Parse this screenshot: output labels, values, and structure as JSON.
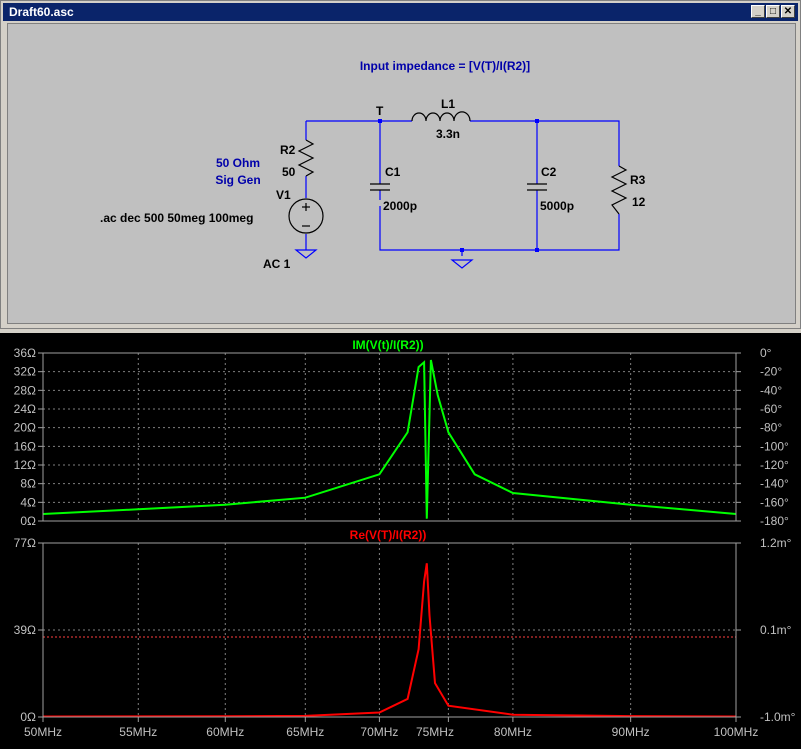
{
  "window": {
    "title": "Draft60.asc",
    "buttons": [
      "_",
      "□",
      "✕"
    ]
  },
  "schematic": {
    "directive": "Input impedance = [V(T)/I(R2)]",
    "node_label": "T",
    "sig_gen_line1": "50 Ohm",
    "sig_gen_line2": "Sig Gen",
    "ac_command": ".ac dec 500 50meg 100meg",
    "components": {
      "R2": {
        "name": "R2",
        "value": "50"
      },
      "V1": {
        "name": "V1",
        "value": "AC 1"
      },
      "L1": {
        "name": "L1",
        "value": "3.3n"
      },
      "C1": {
        "name": "C1",
        "value": "2000p"
      },
      "C2": {
        "name": "C2",
        "value": "5000p"
      },
      "R3": {
        "name": "R3",
        "value": "12"
      }
    }
  },
  "colors": {
    "wire": "#0000ff",
    "label_blue": "#0000aa",
    "grid": "#808080",
    "trace_top": "#00ff00",
    "trace_bottom": "#ff0000",
    "dashed": "#ff4040"
  },
  "plots": {
    "x_ticks": [
      "50MHz",
      "55MHz",
      "60MHz",
      "65MHz",
      "70MHz",
      "75MHz",
      "80MHz",
      "90MHz",
      "100MHz"
    ],
    "top": {
      "title": "IM(V(t)/I(R2))",
      "left_ticks": [
        "36Ω",
        "32Ω",
        "28Ω",
        "24Ω",
        "20Ω",
        "16Ω",
        "12Ω",
        "8Ω",
        "4Ω",
        "0Ω"
      ],
      "right_ticks": [
        "0°",
        "-20°",
        "-40°",
        "-60°",
        "-80°",
        "-100°",
        "-120°",
        "-140°",
        "-160°",
        "-180°"
      ]
    },
    "bottom": {
      "title": "Re(V(T)/I(R2))",
      "left_ticks": [
        "77Ω",
        "39Ω",
        "0Ω"
      ],
      "right_ticks": [
        "1.2m°",
        "0.1m°",
        "-1.0m°"
      ]
    }
  },
  "chart_data": [
    {
      "type": "line",
      "title": "IM(V(t)/I(R2))",
      "xlabel": "",
      "ylabel": "",
      "x_scale": "log",
      "xlim": [
        50,
        100
      ],
      "ylim": [
        0,
        36
      ],
      "x": [
        50,
        55,
        60,
        65,
        70,
        72,
        72.8,
        73.2,
        73.4,
        73.7,
        74.2,
        75,
        77,
        80,
        90,
        100
      ],
      "series": [
        {
          "values": [
            1.5,
            2.5,
            3.5,
            5,
            10,
            19,
            33,
            34,
            0.5,
            34.5,
            27,
            19,
            10,
            6,
            3.5,
            1.5
          ]
        }
      ]
    },
    {
      "type": "line",
      "title": "Re(V(T)/I(R2))",
      "xlabel": "",
      "ylabel": "",
      "x_scale": "log",
      "xlim": [
        50,
        100
      ],
      "ylim": [
        0,
        77
      ],
      "x": [
        50,
        60,
        65,
        70,
        72,
        72.8,
        73.2,
        73.4,
        73.6,
        74,
        75,
        80,
        90,
        100
      ],
      "series": [
        {
          "values": [
            0.2,
            0.3,
            0.5,
            2,
            8,
            30,
            60,
            68,
            45,
            15,
            5,
            1,
            0.4,
            0.2
          ]
        }
      ]
    }
  ]
}
